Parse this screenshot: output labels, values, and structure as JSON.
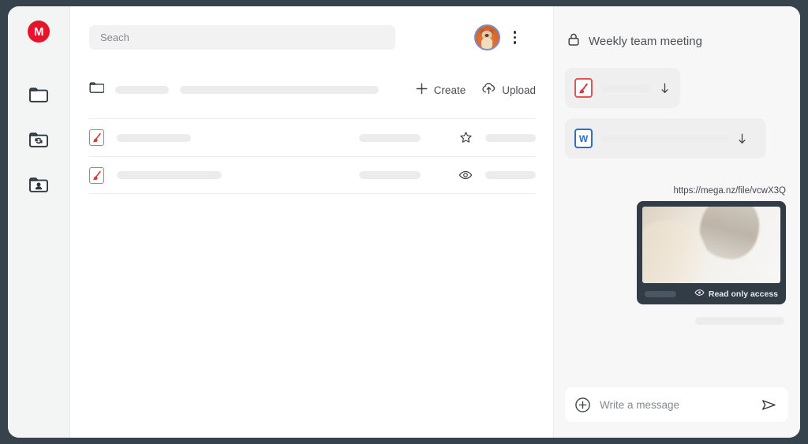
{
  "window": {
    "frame_color": "#36424c",
    "surface_color": "#ffffff"
  },
  "sidebar": {
    "logo": {
      "name": "mega-logo",
      "letter": "M",
      "color": "#e8132a"
    },
    "items": [
      {
        "id": "cloud-drive",
        "icon": "folder-icon"
      },
      {
        "id": "backups",
        "icon": "folder-sync-icon"
      },
      {
        "id": "shared",
        "icon": "folder-shared-icon"
      }
    ]
  },
  "topbar": {
    "search": {
      "placeholder": "Seach",
      "value": ""
    },
    "avatar_name": "user-avatar",
    "menu_name": "more-options-icon"
  },
  "toolbar": {
    "folder_icon": "folder-icon",
    "create_label": "Create",
    "upload_label": "Upload",
    "create_icon": "plus-icon",
    "upload_icon": "cloud-upload-icon"
  },
  "files": {
    "rows": [
      {
        "type": "pdf",
        "icon": "pdf-file-icon",
        "name_width": 94,
        "meta_width": 78,
        "action_icon": "star-icon",
        "tail_width": 64
      },
      {
        "type": "pdf",
        "icon": "pdf-file-icon",
        "name_width": 133,
        "meta_width": 78,
        "action_icon": "eye-icon",
        "tail_width": 64
      }
    ]
  },
  "chat": {
    "lock_icon": "lock-icon",
    "title": "Weekly team meeting",
    "attachments": [
      {
        "icon": "pdf-file-icon",
        "type": "pdf",
        "label": "",
        "action_icon": "download-icon",
        "width": "narrow"
      },
      {
        "icon": "word-file-icon",
        "type": "word",
        "label": "W",
        "action_icon": "download-icon",
        "width": "wide"
      }
    ],
    "link_preview": {
      "url": "https://mega.nz/file/vcwX3Q",
      "access_label": "Read only access",
      "access_icon": "eye-icon",
      "card_color": "#323c47"
    },
    "composer": {
      "add_icon": "plus-circle-icon",
      "placeholder": "Write a message",
      "value": "",
      "send_icon": "send-icon"
    }
  }
}
